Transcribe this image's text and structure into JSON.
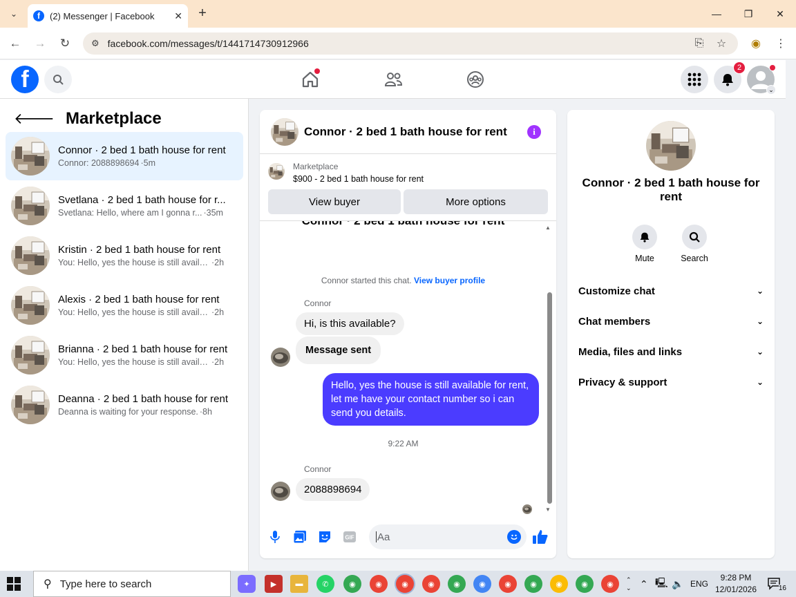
{
  "browser": {
    "tab_title": "(2) Messenger | Facebook",
    "url": "facebook.com/messages/t/1441714730912966",
    "favicon_letter": "f"
  },
  "fb": {
    "logo_letter": "f",
    "notification_count": "2"
  },
  "sidebar": {
    "title": "Marketplace",
    "conversations": [
      {
        "name": "Connor · 2 bed 1 bath house for rent",
        "snippet": "Connor: 2088898694",
        "time": "·5m"
      },
      {
        "name": "Svetlana · 2 bed 1 bath house for r...",
        "snippet": "Svetlana: Hello, where am I gonna r...",
        "time": "·35m"
      },
      {
        "name": "Kristin · 2 bed 1 bath house for rent",
        "snippet": "You: Hello, yes the house is still availa...",
        "time": "·2h"
      },
      {
        "name": "Alexis · 2 bed 1 bath house for rent",
        "snippet": "You: Hello, yes the house is still availa...",
        "time": "·2h"
      },
      {
        "name": "Brianna · 2 bed 1 bath house for rent",
        "snippet": "You: Hello, yes the house is still availa...",
        "time": "·2h"
      },
      {
        "name": "Deanna · 2 bed 1 bath house for rent",
        "snippet": "Deanna is waiting for your response.",
        "time": "·8h"
      }
    ]
  },
  "chat": {
    "title": "Connor · 2 bed 1 bath house for rent",
    "marketplace_label": "Marketplace",
    "listing": "$900 - 2 bed 1 bath house for rent",
    "view_buyer": "View buyer",
    "more_options": "More options",
    "started_text": "Connor started this chat.",
    "view_profile": "View buyer profile",
    "sender1": "Connor",
    "msg1": "Hi, is this available?",
    "msg2": "Message sent",
    "reply": "Hello, yes the house is still available for rent, let me have your contact number so i can send you details.",
    "timestamp": "9:22 AM",
    "sender2": "Connor",
    "msg3": "2088898694",
    "input_placeholder": "Aa"
  },
  "details": {
    "name": "Connor · 2 bed 1 bath house for rent",
    "mute": "Mute",
    "search": "Search",
    "rows": [
      "Customize chat",
      "Chat members",
      "Media, files and links",
      "Privacy & support"
    ]
  },
  "taskbar": {
    "search_placeholder": "Type here to search",
    "lang": "ENG",
    "time": "9:28 PM",
    "date": "12/01/2026",
    "notif_count": "16"
  },
  "colors": {
    "fb_blue": "#0866ff",
    "outgoing_bubble": "#4b3cff",
    "badge_red": "#e41e3f",
    "info_purple": "#a033ff"
  }
}
